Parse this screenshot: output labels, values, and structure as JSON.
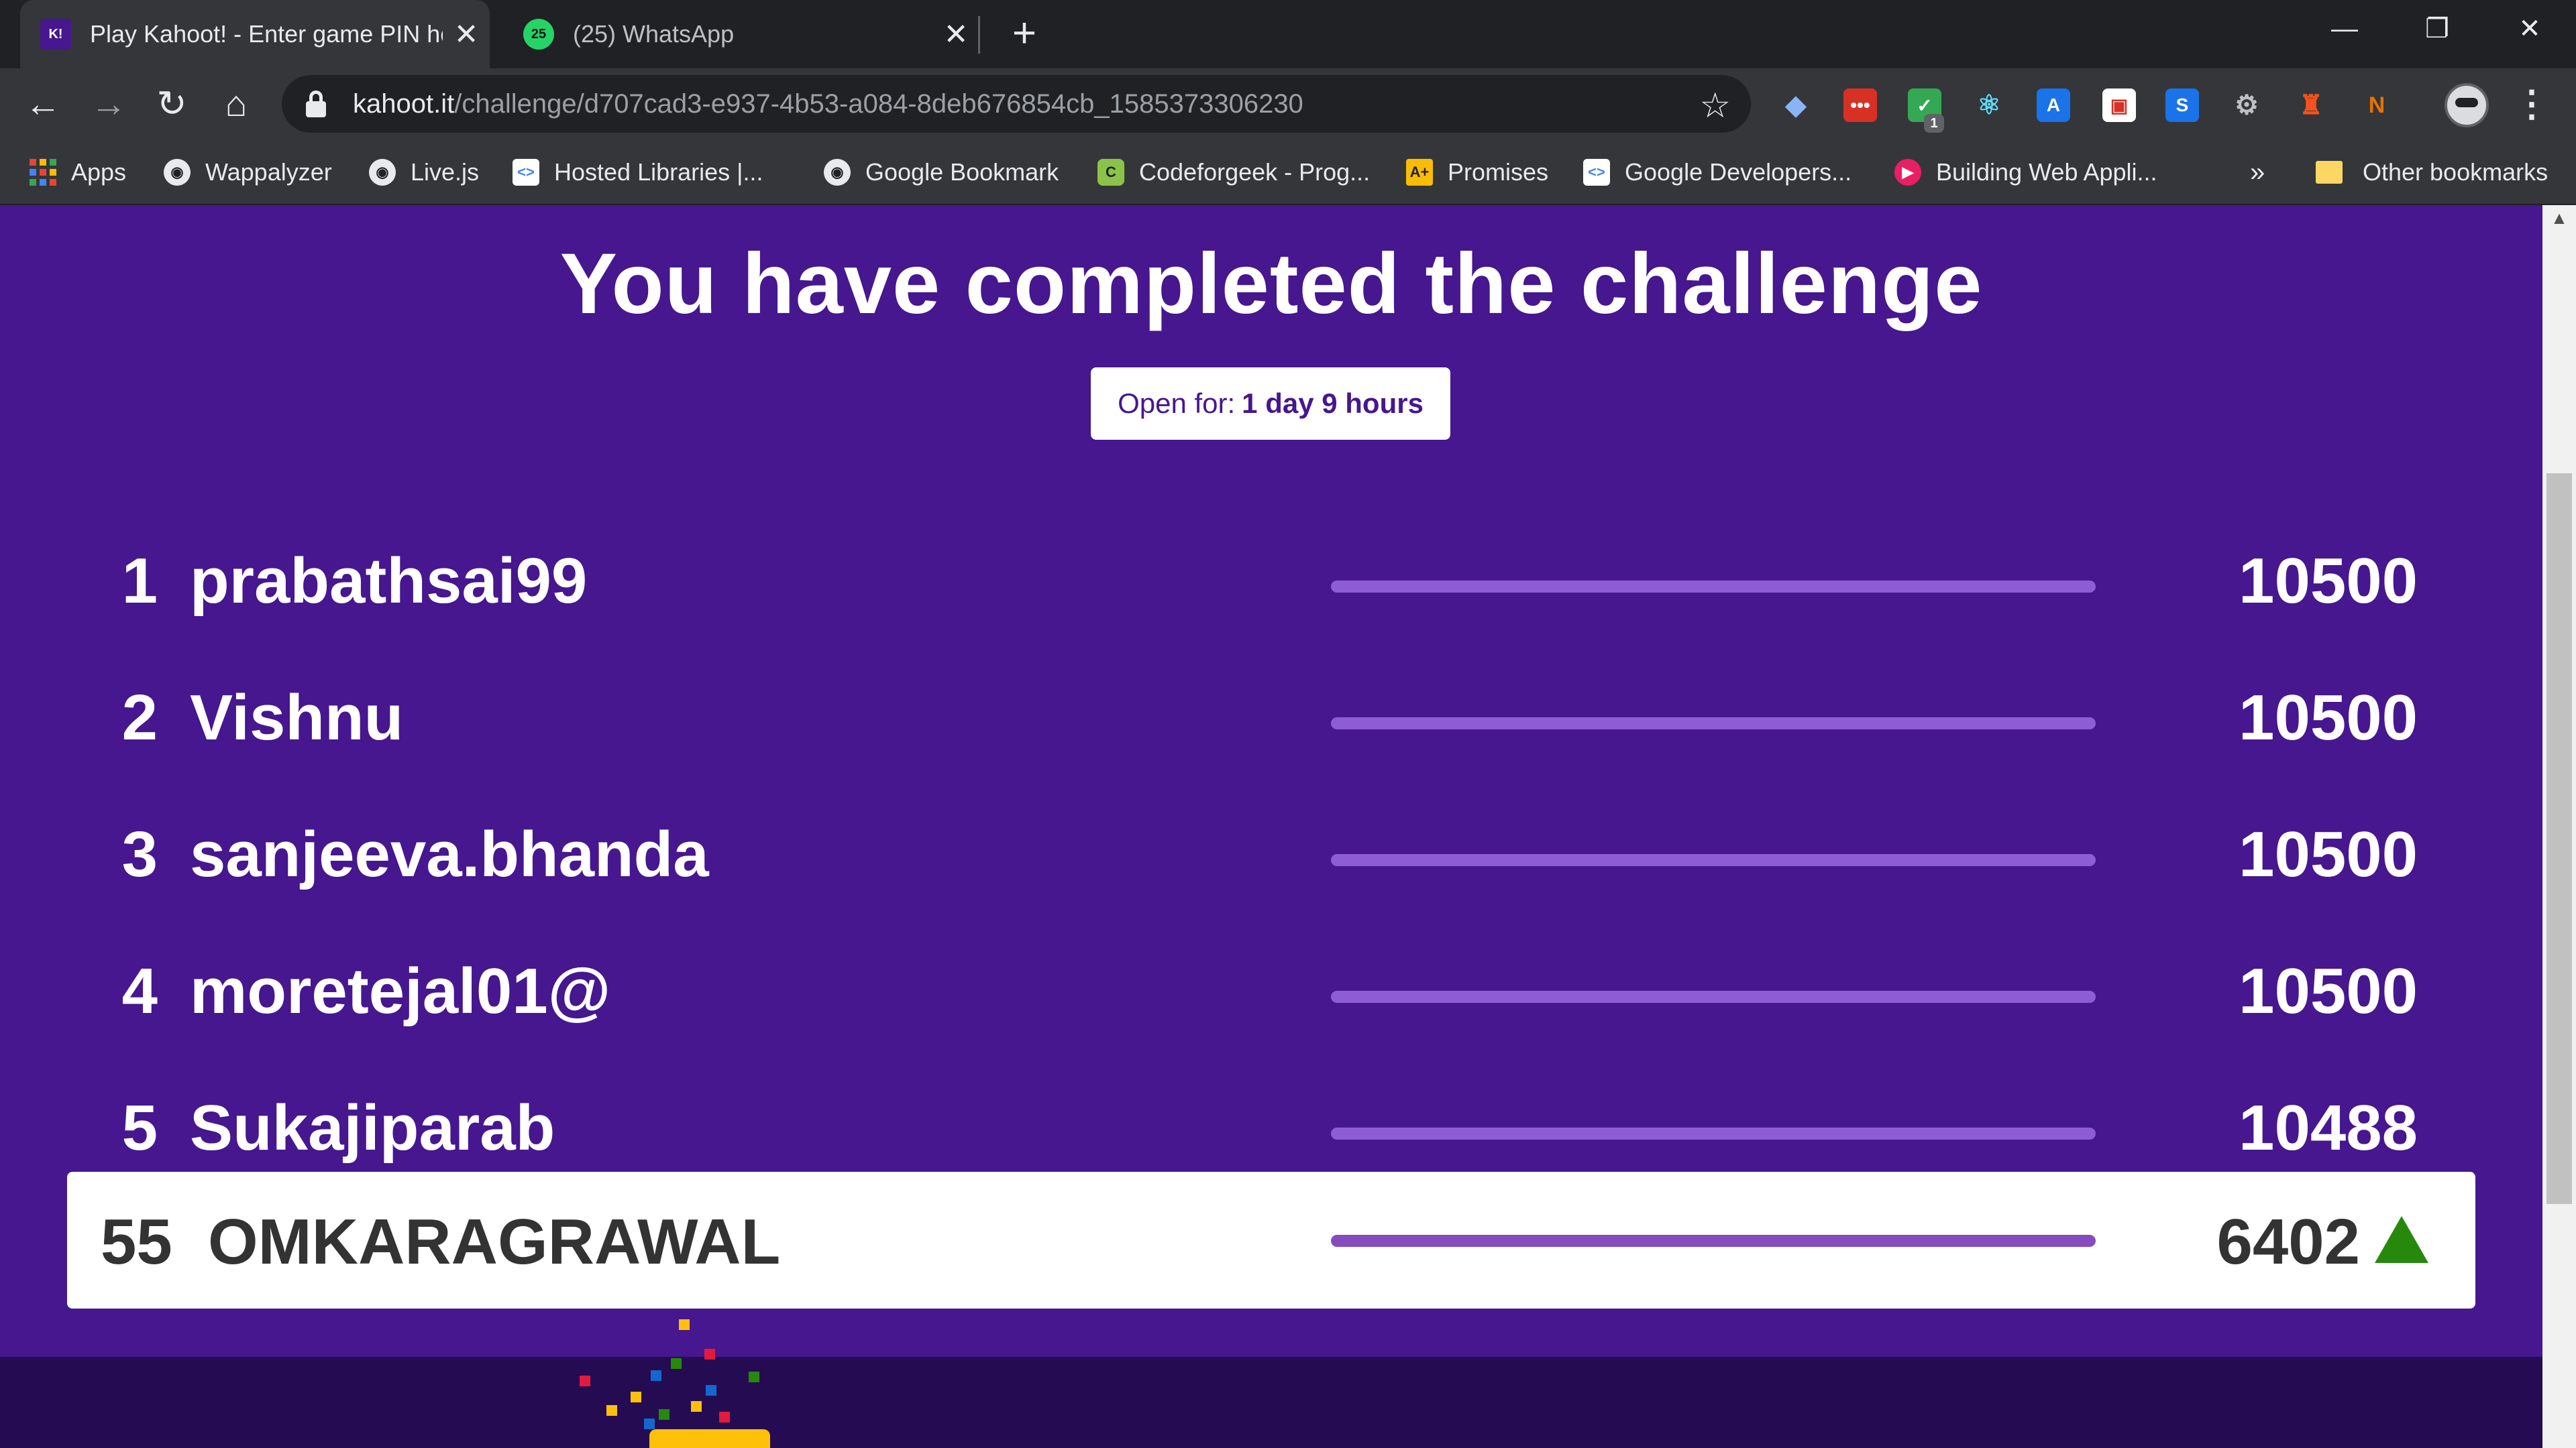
{
  "browser": {
    "tabs": [
      {
        "title": "Play Kahoot! - Enter game PIN he",
        "favicon": "kahoot-icon",
        "active": true
      },
      {
        "title": "(25) WhatsApp",
        "favicon": "whatsapp-icon",
        "badge": "25",
        "active": false
      }
    ],
    "url_host": "kahoot.it",
    "url_path": "/challenge/d707cad3-e937-4b53-a084-8deb676854cb_1585373306230",
    "extensions": [
      "diamond-icon",
      "dots-icon",
      "shield-check-icon",
      "react-icon",
      "translate-icon",
      "calendar-icon",
      "s-icon",
      "gear-icon",
      "fire-icon",
      "pen-icon"
    ],
    "extension_badge": "1",
    "bookmarks": [
      {
        "label": "Apps",
        "icon": "apps-grid-icon"
      },
      {
        "label": "Wappalyzer",
        "icon": "globe-icon"
      },
      {
        "label": "Live.js",
        "icon": "globe-icon"
      },
      {
        "label": "Hosted Libraries  |...",
        "icon": "code-icon"
      },
      {
        "label": "Google Bookmark",
        "icon": "globe-icon"
      },
      {
        "label": "Codeforgeek - Prog...",
        "icon": "hexagon-icon"
      },
      {
        "label": "Promises",
        "icon": "a-plus-icon"
      },
      {
        "label": "Google Developers...",
        "icon": "code-icon"
      },
      {
        "label": "Building Web Appli...",
        "icon": "play-icon"
      },
      {
        "label": "Other bookmarks",
        "icon": "folder-icon"
      }
    ],
    "overflow": "»"
  },
  "page": {
    "title": "You have completed the challenge",
    "open_for_label": "Open for:",
    "open_for_value": "1 day 9 hours"
  },
  "leaderboard": [
    {
      "rank": "1",
      "name": "prabathsai99",
      "score": "10500"
    },
    {
      "rank": "2",
      "name": "Vishnu",
      "score": "10500"
    },
    {
      "rank": "3",
      "name": "sanjeeva.bhanda",
      "score": "10500"
    },
    {
      "rank": "4",
      "name": "moretejal01@",
      "score": "10500"
    },
    {
      "rank": "5",
      "name": "Sukajiparab",
      "score": "10488"
    }
  ],
  "current_player": {
    "rank": "55",
    "name": "OMKARAGRAWAL",
    "score": "6402",
    "trend": "up"
  },
  "colors": {
    "background": "#46178f",
    "footer": "#250b52",
    "bar": "#864cbf",
    "trend_up": "#26890c"
  }
}
